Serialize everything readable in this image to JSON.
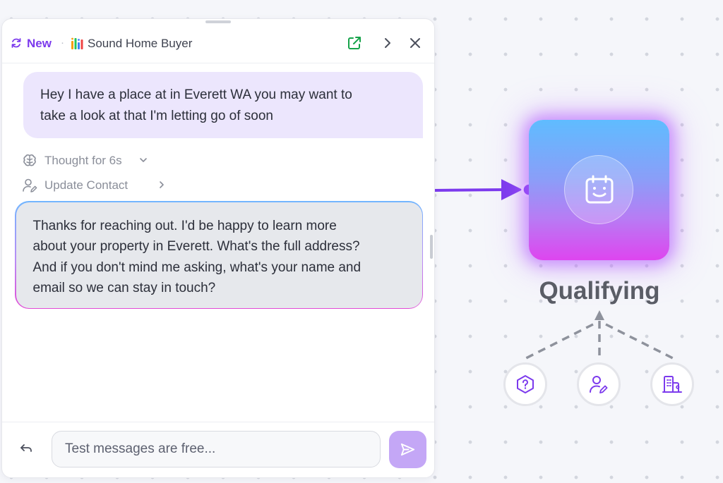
{
  "chat": {
    "header": {
      "new_label": "New",
      "separator": "·",
      "agent_name": "Sound Home Buyer",
      "icons": [
        "refresh-icon",
        "bot-bars-icon",
        "open-external-icon",
        "chevron-right-icon",
        "close-icon"
      ]
    },
    "messages": [
      {
        "role": "user",
        "line1": "Hey I have a place at in Everett WA you may want to",
        "line2": "take a look at that I'm letting go of soon"
      },
      {
        "role": "assistant",
        "line1": "Thanks for reaching out. I'd be happy to learn more",
        "line2": "about your property in Everett. What's the full address?",
        "line3": "And if you don't mind me asking, what's your name and",
        "line4": "email so we can stay in touch?"
      }
    ],
    "thought_label": "Thought for 6s",
    "action_label": "Update Contact",
    "input_placeholder": "Test messages are free...",
    "input_value": ""
  },
  "flow": {
    "node_label": "Qualifying",
    "node_icon": "calendar-smile-icon",
    "sub_icons": [
      "question-hexagon-icon",
      "user-edit-icon",
      "building-icon"
    ]
  },
  "colors": {
    "accent": "#7c3aed",
    "user_bubble": "#ece6fd",
    "bot_bubble": "#e6e8ec",
    "send_button": "#c4a7f6",
    "connector_arrow": "#7c3aed",
    "external_link_icon": "#16a34a"
  }
}
